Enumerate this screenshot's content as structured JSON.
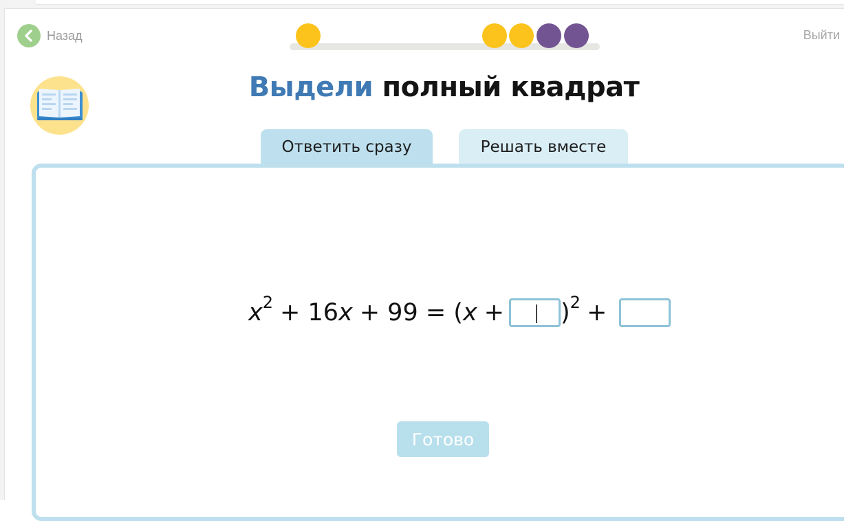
{
  "nav": {
    "back_label": "Назад",
    "exit_label": "Выйти"
  },
  "progress": {
    "dots": [
      "yellow",
      "yellow",
      "yellow",
      "purple",
      "purple"
    ],
    "colors": {
      "yellow": "#fbc31b",
      "purple": "#735492"
    }
  },
  "task": {
    "title_highlight": "Выдели",
    "title_rest": "полный квадрат"
  },
  "tabs": [
    {
      "label": "Ответить сразу",
      "active": true
    },
    {
      "label": "Решать вместе",
      "active": false
    }
  ],
  "equation": {
    "x": "x",
    "sup2": "2",
    "plus16": "+ 16",
    "x2": "x",
    "eq99": "+ 99 = (",
    "x3": "x",
    "plus": "+",
    "close": ")",
    "sup2b": "2",
    "plus_end": "+",
    "answer1": "",
    "answer2": ""
  },
  "actions": {
    "done_label": "Готово"
  }
}
